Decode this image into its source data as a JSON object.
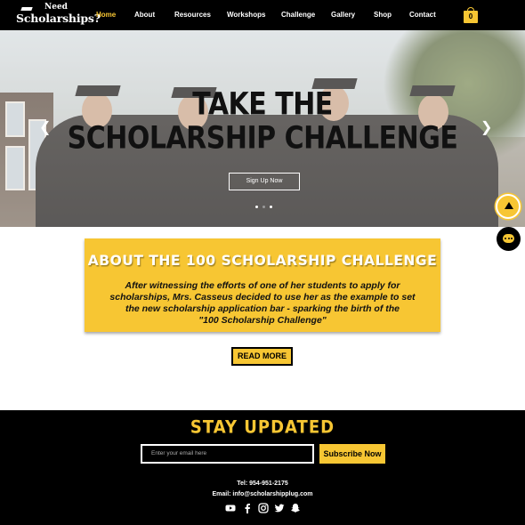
{
  "header": {
    "logo_line1": "Need",
    "logo_line2": "Scholarships?",
    "nav": [
      {
        "label": "Home",
        "active": true
      },
      {
        "label": "Resources"
      },
      {
        "label": "About"
      },
      {
        "label": "Workshops"
      },
      {
        "label": "Challenge"
      },
      {
        "label": "Gallery"
      },
      {
        "label": "Shop"
      },
      {
        "label": "Contact"
      }
    ],
    "cart_count": "0"
  },
  "hero": {
    "title_line1": "TAKE THE",
    "title_line2": "SCHOLARSHIP CHALLENGE",
    "cta": "Sign Up Now",
    "prev_icon": "chevron-left-icon",
    "next_icon": "chevron-right-icon",
    "slide_count": 3,
    "active_slide": 1
  },
  "about": {
    "title": "ABOUT THE 100 SCHOLARSHIP CHALLENGE",
    "lines": [
      "After witnessing the efforts of one of her students to apply for",
      "scholarships, Mrs. Casseus decided to use her as the example to set",
      "the new scholarship application bar - sparking the birth of the",
      "\"100 Scholarship Challenge\""
    ],
    "read_more": "READ MORE"
  },
  "footer": {
    "heading": "STAY UPDATED",
    "email_placeholder": "Enter your email here",
    "subscribe": "Subscribe Now",
    "tel": "Tel: 954-951-2175",
    "email": "Email: info@scholarshipplug.com",
    "socials": [
      "youtube-icon",
      "facebook-icon",
      "instagram-icon",
      "twitter-icon",
      "snapchat-icon"
    ]
  },
  "colors": {
    "accent": "#f7c633",
    "dark": "#000000"
  }
}
